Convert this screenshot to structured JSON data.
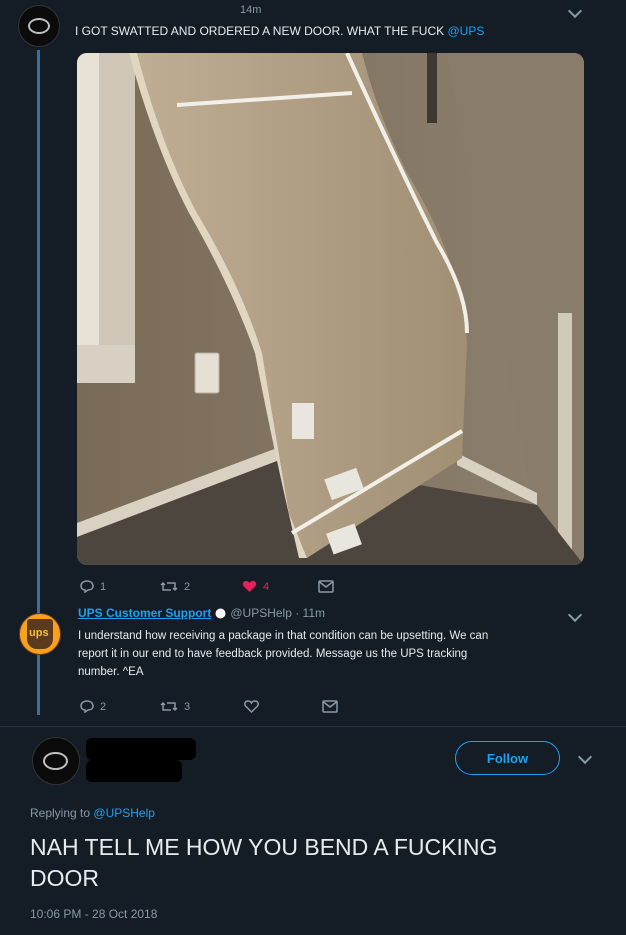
{
  "tweet1": {
    "time": "14m",
    "text": "I GOT SWATTED AND ORDERED A NEW DOOR. WHAT THE FUCK",
    "mention": "@UPS",
    "reply_count": "1",
    "retweet_count": "2",
    "like_count": "4"
  },
  "tweet2": {
    "display_name": "UPS Customer Support",
    "handle_time": "@UPSHelp · 11m",
    "avatar_text": "ups",
    "text_line1": "I understand how receiving a package in that condition can be upsetting. We can",
    "text_line2": "report it in our end to have feedback provided. Message us the UPS tracking",
    "text_line3": "number. ^EA",
    "reply_count": "2",
    "retweet_count": "3"
  },
  "tweet3": {
    "follow_label": "Follow",
    "replying_prefix": "Replying to",
    "replying_handle": "@UPSHelp",
    "text_line1": "NAH TELL ME HOW YOU BEND A FUCKING",
    "text_line2": "DOOR",
    "timestamp": "10:06 PM - 28 Oct 2018"
  },
  "colors": {
    "background": "#141d26",
    "accent": "#1da1f2",
    "like": "#e0245e",
    "thread": "#3b6f99"
  }
}
